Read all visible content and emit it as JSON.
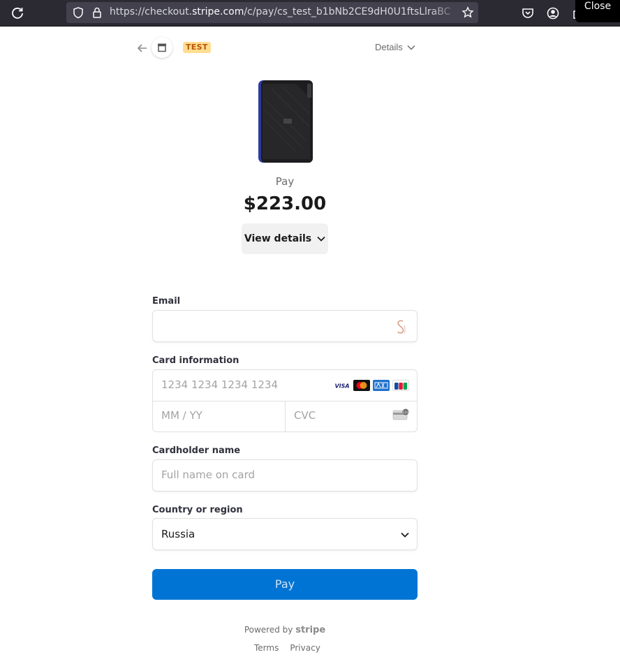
{
  "browser": {
    "url_prefix": "https://checkout.",
    "url_host": "stripe.com",
    "url_path": "/c/pay/cs_test_b1bNb2CE9dH0U1ftsLlraBC",
    "close_label": "Close"
  },
  "header": {
    "test_badge": "TEST",
    "details_label": "Details"
  },
  "product": {
    "pay_label": "Pay",
    "amount": "$223.00",
    "view_details_label": "View details"
  },
  "form": {
    "email_label": "Email",
    "email_value": "",
    "card_label": "Card information",
    "card_number_placeholder": "1234 1234 1234 1234",
    "expiry_placeholder": "MM / YY",
    "cvc_placeholder": "CVC",
    "card_brands": [
      "VISA",
      "Mastercard",
      "American Express",
      "JCB"
    ],
    "cardholder_label": "Cardholder name",
    "cardholder_placeholder": "Full name on card",
    "country_label": "Country or region",
    "country_value": "Russia",
    "pay_button": "Pay"
  },
  "footer": {
    "powered_by": "Powered by",
    "stripe": "stripe",
    "terms": "Terms",
    "privacy": "Privacy"
  },
  "colors": {
    "accent": "#0074d4",
    "test_badge_bg": "#ffde92",
    "test_badge_text": "#bb5504",
    "browser_bg": "#2b2a33"
  }
}
